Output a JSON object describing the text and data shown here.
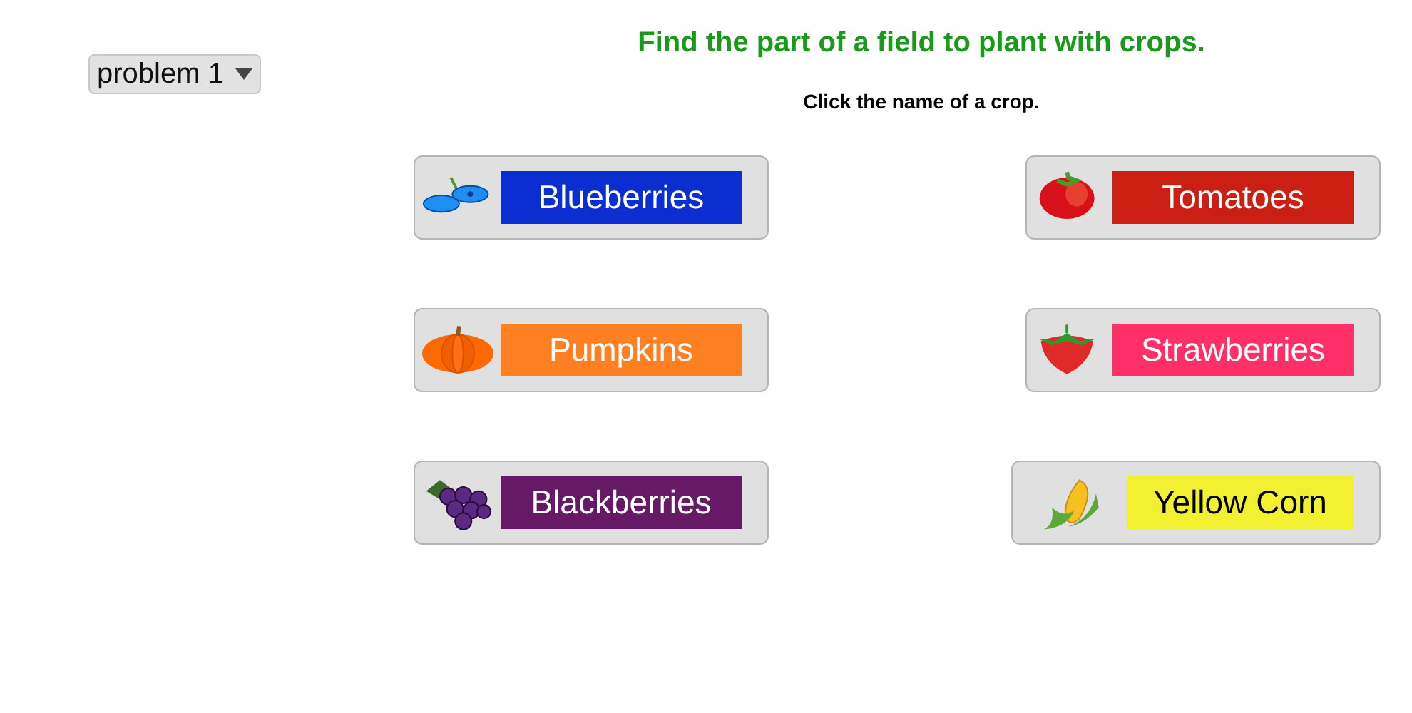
{
  "problem_select": {
    "value": "problem 1"
  },
  "title": "Find the part of a field to plant with crops.",
  "instruction": "Click the name of a crop.",
  "crops": [
    {
      "label": "Blueberries",
      "color": "#0a2ecf",
      "kind": "blueberry"
    },
    {
      "label": "Tomatoes",
      "color": "#cc1f14",
      "kind": "tomato"
    },
    {
      "label": "Pumpkins",
      "color": "#ff8022",
      "kind": "pumpkin"
    },
    {
      "label": "Strawberries",
      "color": "#ff3068",
      "kind": "strawberry"
    },
    {
      "label": "Blackberries",
      "color": "#661a66",
      "kind": "grapes"
    },
    {
      "label": "Yellow Corn",
      "color": "#f2f030",
      "kind": "corn"
    }
  ]
}
